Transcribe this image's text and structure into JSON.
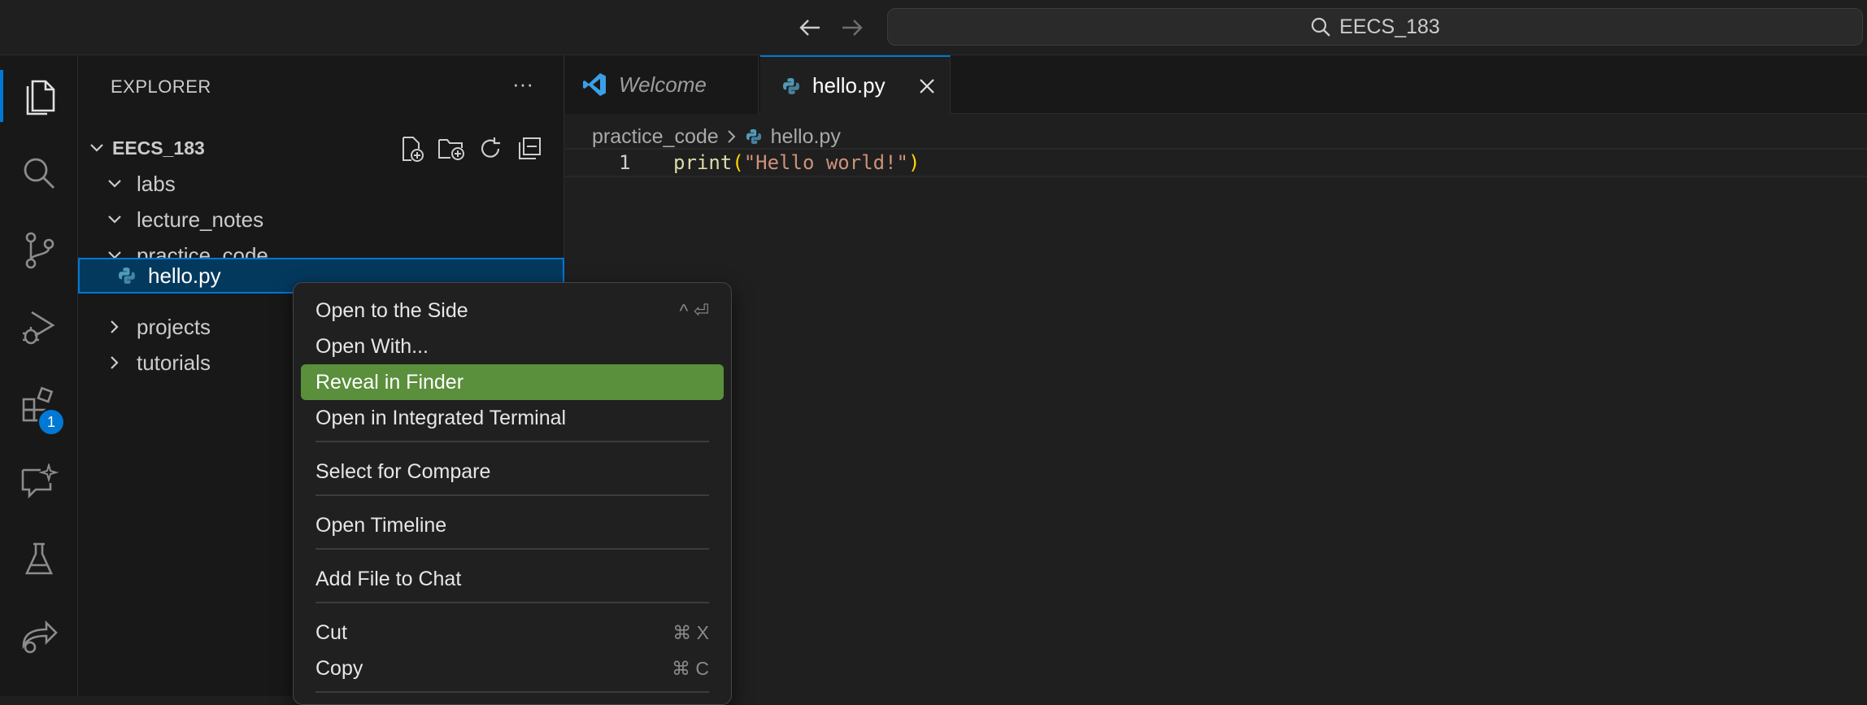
{
  "titlebar": {
    "search_text": "EECS_183"
  },
  "activity_bar": {
    "extensions_badge": "1"
  },
  "explorer": {
    "title": "EXPLORER",
    "more": "···",
    "root": "EECS_183",
    "tree": [
      {
        "label": "labs",
        "expanded": true
      },
      {
        "label": "lecture_notes",
        "expanded": true
      },
      {
        "label": "practice_code",
        "expanded": true
      },
      {
        "label": "hello.py",
        "selected": true
      },
      {
        "label": "projects",
        "expanded": false
      },
      {
        "label": "tutorials",
        "expanded": false
      }
    ]
  },
  "tabs": [
    {
      "label": "Welcome",
      "active": false
    },
    {
      "label": "hello.py",
      "active": true
    }
  ],
  "breadcrumb": {
    "folder": "practice_code",
    "file": "hello.py"
  },
  "code": {
    "line_number": "1",
    "fn": "print",
    "open_paren": "(",
    "string": "\"Hello world!\"",
    "close_paren": ")"
  },
  "context_menu": {
    "items": [
      {
        "label": "Open to the Side",
        "shortcut": "^ ⏎"
      },
      {
        "label": "Open With..."
      },
      {
        "label": "Reveal in Finder",
        "highlighted": true
      },
      {
        "label": "Open in Integrated Terminal"
      },
      {
        "label": "Select for Compare"
      },
      {
        "label": "Open Timeline"
      },
      {
        "label": "Add File to Chat"
      },
      {
        "label": "Cut",
        "shortcut": "⌘ X"
      },
      {
        "label": "Copy",
        "shortcut": "⌘ C"
      }
    ]
  },
  "colors": {
    "accent": "#0078d4",
    "menu_highlight": "#5a8f3b",
    "selection": "#04395e",
    "python_icon": "#519aba"
  }
}
